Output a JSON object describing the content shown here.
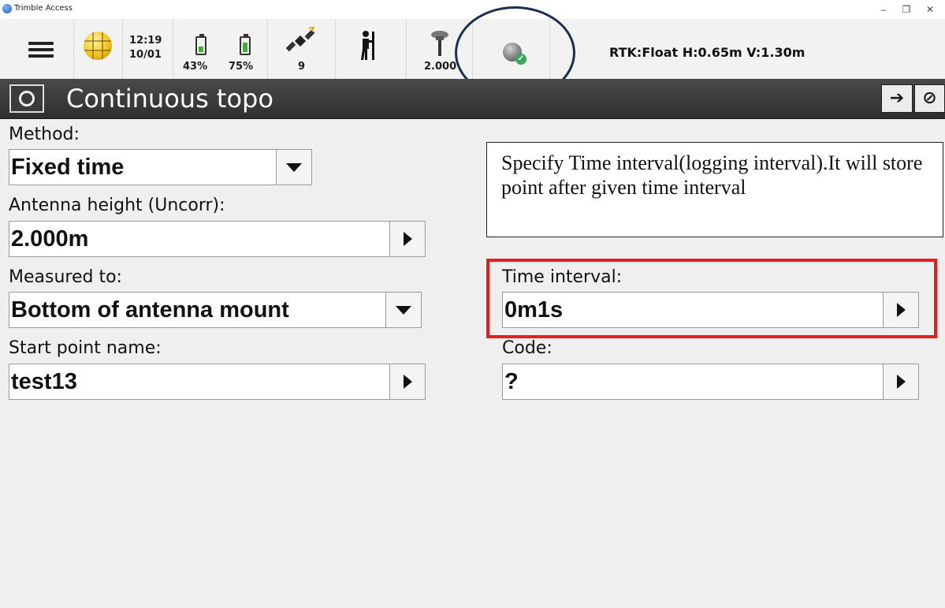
{
  "window": {
    "app_title": "Trimble Access",
    "minimize": "–",
    "restore": "❐",
    "close": "✕"
  },
  "statusbar": {
    "time": "12:19",
    "date": "10/01",
    "battery1": "43%",
    "battery1_level": 0.43,
    "battery2": "75%",
    "battery2_level": 0.75,
    "satellites": "9",
    "antenna_height": "2.000",
    "rtk_status": "RTK:Float H:0.65m V:1.30m"
  },
  "header": {
    "title": "Continuous topo",
    "enter_glyph": "➔",
    "edit_glyph": "⊘"
  },
  "form": {
    "method_label": "Method:",
    "method_value": "Fixed time",
    "antenna_label": "Antenna height (Uncorr):",
    "antenna_value": "2.000m",
    "measured_label": "Measured to:",
    "measured_value": "Bottom of antenna mount",
    "start_label": "Start point name:",
    "start_value": "test13",
    "interval_label": "Time interval:",
    "interval_value": "0m1s",
    "code_label": "Code:",
    "code_value": "?"
  },
  "callout": {
    "text": "Specify Time interval(logging interval).It will store point after given time interval"
  },
  "colors": {
    "header_bg": "#3a3a3a",
    "annotation_red": "#e81c1c",
    "annotation_circle": "#1b2f52",
    "rtk_underline": "#1f4a84",
    "battery_fill": "#3fae3a"
  }
}
